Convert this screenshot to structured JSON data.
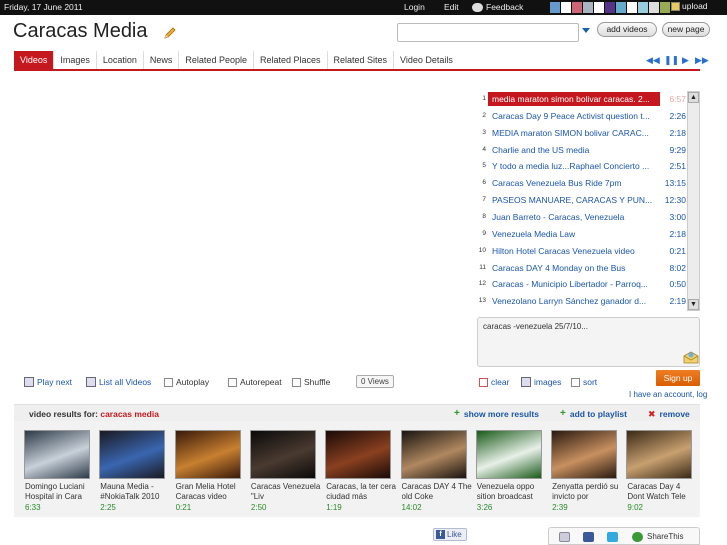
{
  "topbar": {
    "date": "Friday, 17 June 2011",
    "login": "Login",
    "edit": "Edit",
    "feedback": "Feedback",
    "upload": "upload",
    "swatches": [
      "#6699cc",
      "#ffffff",
      "#cc6677",
      "#aab4c0",
      "#ffffff",
      "#553388",
      "#66aacc",
      "#ffffff",
      "#99ccdd",
      "#dddddd",
      "#99aa55"
    ]
  },
  "header": {
    "title": "Caracas Media",
    "search_value": "",
    "add_videos": "add videos",
    "new_page": "new page"
  },
  "tabs": [
    "Videos",
    "Images",
    "Location",
    "News",
    "Related People",
    "Related Places",
    "Related Sites",
    "Video Details"
  ],
  "playlist": [
    {
      "num": "1",
      "title": "media maraton simon bolivar caracas. 2...",
      "dur": "6:57"
    },
    {
      "num": "2",
      "title": "Caracas Day 9 Peace Activist question t...",
      "dur": "2:26"
    },
    {
      "num": "3",
      "title": "MEDIA maraton SIMON bolivar CARAC...",
      "dur": "2:18"
    },
    {
      "num": "4",
      "title": "Charlie and the US media",
      "dur": "9:29"
    },
    {
      "num": "5",
      "title": "Y todo a media luz...Raphael Concierto ...",
      "dur": "2:51"
    },
    {
      "num": "6",
      "title": "Caracas Venezuela Bus Ride 7pm",
      "dur": "13:15"
    },
    {
      "num": "7",
      "title": "PASEOS MANUARE, CARACAS Y PUN...",
      "dur": "12:30"
    },
    {
      "num": "8",
      "title": "Juan Barreto - Caracas, Venezuela",
      "dur": "3:00"
    },
    {
      "num": "9",
      "title": "Venezuela Media Law",
      "dur": "2:18"
    },
    {
      "num": "10",
      "title": "Hilton Hotel Caracas Venezuela video",
      "dur": "0:21"
    },
    {
      "num": "11",
      "title": "Caracas DAY 4 Monday on the Bus",
      "dur": "8:02"
    },
    {
      "num": "12",
      "title": "Caracas - Municipio Libertador - Parroq...",
      "dur": "0:50"
    },
    {
      "num": "13",
      "title": "Venezolano Larryn Sánchez ganador d...",
      "dur": "2:19"
    }
  ],
  "description": "caracas -venezuela 25/7/10...",
  "controls": {
    "play_next": "Play next",
    "list_all": "List all Videos",
    "autoplay": "Autoplay",
    "autorepeat": "Autorepeat",
    "shuffle": "Shuffle",
    "views": "0 Views",
    "clear": "clear",
    "images": "images",
    "sort": "sort",
    "signup": "Sign up",
    "account": "I have an account, log"
  },
  "results": {
    "label": "video results for:",
    "query": "caracas media",
    "show_more": "show more results",
    "add_to_playlist": "add to playlist",
    "remove": "remove"
  },
  "thumbs": [
    {
      "cap": "Domingo Luciani Hospital in Cara",
      "dur": "6:33",
      "c1": "#2c3a48",
      "c2": "#c8d0d8"
    },
    {
      "cap": "Mauna Media - #NokiaTalk 2010",
      "dur": "2:25",
      "c1": "#1a1a22",
      "c2": "#3a66b0"
    },
    {
      "cap": "Gran Melia Hotel Caracas video",
      "dur": "0:21",
      "c1": "#3a1a0a",
      "c2": "#c88030"
    },
    {
      "cap": "Caracas Venezuela \"Liv",
      "dur": "2:50",
      "c1": "#0a0a0a",
      "c2": "#4a3a30"
    },
    {
      "cap": "Caracas, la ter cera ciudad más",
      "dur": "1:19",
      "c1": "#1a0a08",
      "c2": "#8a4020"
    },
    {
      "cap": "Caracas DAY 4 The old Coke",
      "dur": "14:02",
      "c1": "#1a1410",
      "c2": "#b08860"
    },
    {
      "cap": "Venezuela oppo sition broadcast",
      "dur": "3:26",
      "c1": "#1a5a1a",
      "c2": "#e8f0e8"
    },
    {
      "cap": "Zenyatta perdió su invicto por",
      "dur": "2:39",
      "c1": "#2a1a10",
      "c2": "#c89060"
    },
    {
      "cap": "Caracas Day 4 Dont Watch Tele",
      "dur": "9:02",
      "c1": "#3a2a18",
      "c2": "#c8a070"
    }
  ],
  "footer": {
    "like": "Like",
    "share": "ShareThis"
  }
}
